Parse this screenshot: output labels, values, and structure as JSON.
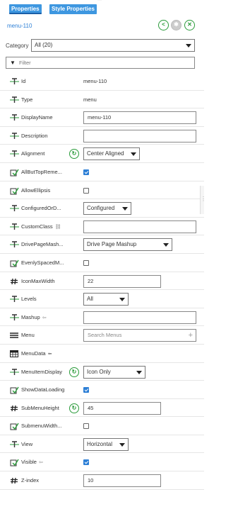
{
  "tabs": [
    {
      "label": "Properties",
      "active": true
    },
    {
      "label": "Style Properties",
      "active": false
    }
  ],
  "header": {
    "title": "menu-110",
    "buttons": [
      "share-icon",
      "gear-icon",
      "close-icon"
    ]
  },
  "category": {
    "label": "Category",
    "value": "All (20)"
  },
  "filter": {
    "placeholder": "Filter"
  },
  "properties": [
    {
      "name": "Id",
      "icon": "text-type-icon",
      "kind": "static",
      "value": "menu-110"
    },
    {
      "name": "Type",
      "icon": "text-type-icon",
      "kind": "static",
      "value": "menu"
    },
    {
      "name": "DisplayName",
      "icon": "text-type-icon",
      "kind": "text",
      "value": "menu-110"
    },
    {
      "name": "Description",
      "icon": "text-type-icon",
      "kind": "text",
      "value": ""
    },
    {
      "name": "Alignment",
      "icon": "text-type-icon",
      "kind": "select",
      "value": "Center Aligned",
      "refresh": true
    },
    {
      "name": "AllButTopReme...",
      "icon": "checkbox-type-icon",
      "kind": "checkbox",
      "checked": true
    },
    {
      "name": "AllowEllipsis",
      "icon": "checkbox-type-icon",
      "kind": "checkbox",
      "checked": false
    },
    {
      "name": "ConfiguredOrD...",
      "icon": "text-type-icon",
      "kind": "select",
      "value": "Configured"
    },
    {
      "name": "CustomClass",
      "icon": "text-type-icon",
      "kind": "text",
      "value": "",
      "suffix": "link-icon"
    },
    {
      "name": "DrivePageMash...",
      "icon": "text-type-icon",
      "kind": "select",
      "value": "Drive Page Mashup"
    },
    {
      "name": "EvenlySpacedM...",
      "icon": "checkbox-type-icon",
      "kind": "checkbox",
      "checked": false
    },
    {
      "name": "IconMaxWidth",
      "icon": "number-type-icon",
      "kind": "text",
      "value": "22"
    },
    {
      "name": "Levels",
      "icon": "text-type-icon",
      "kind": "select",
      "value": "All"
    },
    {
      "name": "Mashup",
      "icon": "text-type-icon",
      "kind": "text",
      "value": "",
      "suffix": "arrow-in-icon"
    },
    {
      "name": "Menu",
      "icon": "list-type-icon",
      "kind": "search",
      "placeholder": "Search Menus"
    },
    {
      "name": "MenuData",
      "icon": "table-type-icon",
      "kind": "none",
      "suffix": "arrow-left-icon"
    },
    {
      "name": "MenuItemDisplay",
      "icon": "text-type-icon",
      "kind": "select",
      "value": "Icon Only",
      "refresh": true
    },
    {
      "name": "ShowDataLoading",
      "icon": "checkbox-type-icon",
      "kind": "checkbox",
      "checked": true
    },
    {
      "name": "SubMenuHeight",
      "icon": "number-type-icon",
      "kind": "text",
      "value": "45",
      "refresh": true
    },
    {
      "name": "SubmenuWidth...",
      "icon": "checkbox-type-icon",
      "kind": "checkbox",
      "checked": false
    },
    {
      "name": "View",
      "icon": "text-type-icon",
      "kind": "select",
      "value": "Horizontal"
    },
    {
      "name": "Visible",
      "icon": "checkbox-type-icon",
      "kind": "checkbox",
      "checked": true,
      "suffix": "arrow-in-icon"
    },
    {
      "name": "Z-index",
      "icon": "number-type-icon",
      "kind": "text",
      "value": "10"
    }
  ],
  "colors": {
    "accent": "#2d7fd6",
    "tab": "#3e97e0",
    "action_green": "#2a9b3a"
  }
}
